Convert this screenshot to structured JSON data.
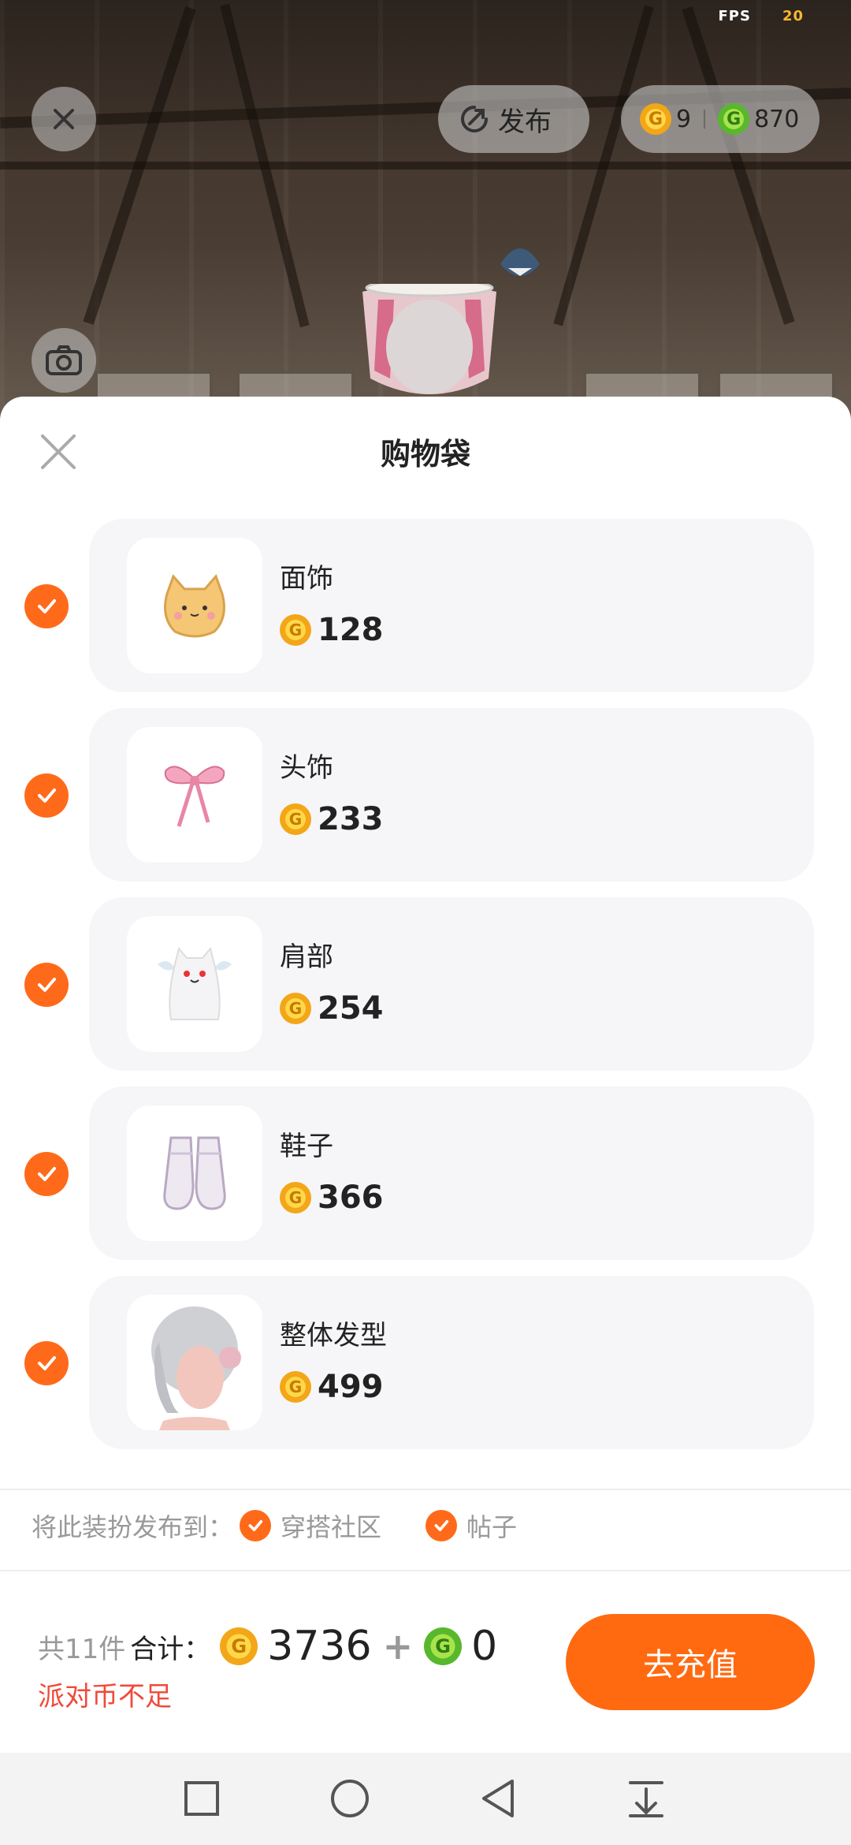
{
  "hud": {
    "fps_label": "FPS",
    "fps_value": "20",
    "publish_label": "发布",
    "gold_coins": "9",
    "green_coins": "870"
  },
  "sheet": {
    "title": "购物袋",
    "items": [
      {
        "name": "面饰",
        "price": "128",
        "checked": true,
        "thumb": "cat-mask"
      },
      {
        "name": "头饰",
        "price": "233",
        "checked": true,
        "thumb": "pink-bow"
      },
      {
        "name": "肩部",
        "price": "254",
        "checked": true,
        "thumb": "ghost-pet"
      },
      {
        "name": "鞋子",
        "price": "366",
        "checked": true,
        "thumb": "fluffy-shoes"
      },
      {
        "name": "整体发型",
        "price": "499",
        "checked": true,
        "thumb": "silver-hair"
      }
    ],
    "publish_to_label": "将此装扮发布到：",
    "publish_options": [
      {
        "label": "穿搭社区",
        "checked": true
      },
      {
        "label": "帖子",
        "checked": true
      }
    ],
    "footer": {
      "count_label": "共11件",
      "sum_label": "合计：",
      "gold_total": "3736",
      "plus": "+",
      "green_total": "0",
      "warning": "派对币不足",
      "recharge_button": "去充值"
    }
  },
  "colors": {
    "accent": "#ff6a10",
    "warning": "#f04a3a",
    "gold_coin": "#f3a617",
    "green_coin": "#57b82b"
  },
  "icons": {
    "close": "close-icon",
    "camera": "camera-icon",
    "publish": "publish-icon",
    "check": "check-icon",
    "nav_recent": "square-icon",
    "nav_home": "circle-icon",
    "nav_back": "triangle-back-icon",
    "nav_menu": "pull-down-icon"
  }
}
